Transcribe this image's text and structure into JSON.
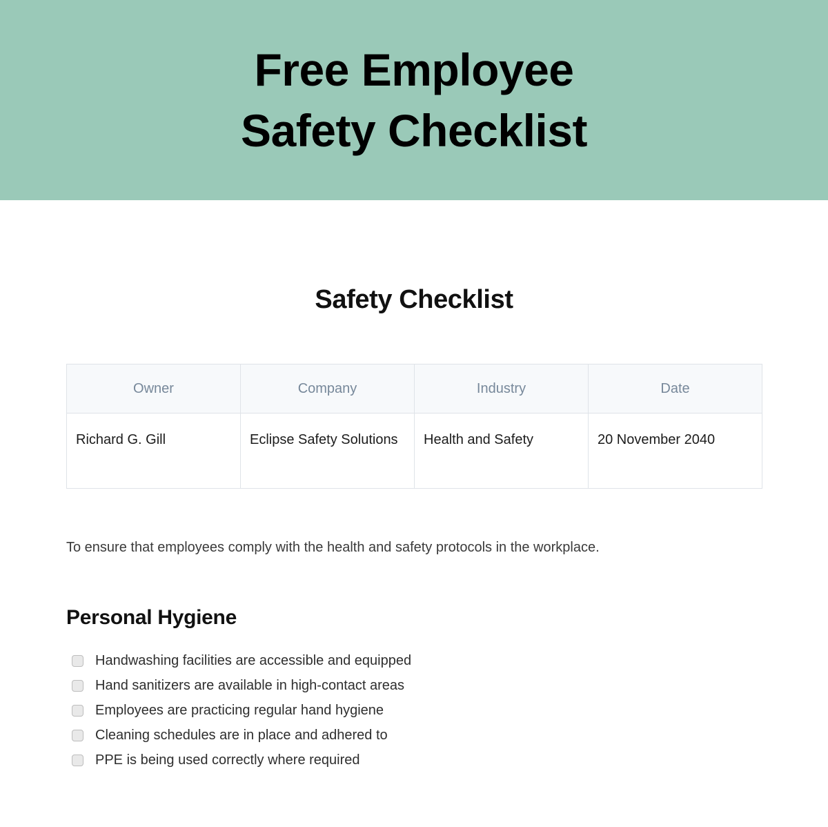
{
  "banner": {
    "title": "Free Employee Safety Checklist",
    "background_color": "#9ac9b8",
    "text_color": "#000000"
  },
  "document": {
    "title": "Safety Checklist",
    "intro": "To ensure that employees comply with the health and safety protocols in the workplace."
  },
  "info_table": {
    "header_background_color": "#f7f9fb",
    "header_text_color": "#77889a",
    "border_color": "#dfe3e8",
    "columns": [
      "Owner",
      "Company",
      "Industry",
      "Date"
    ],
    "rows": [
      [
        "Richard G. Gill",
        "Eclipse Safety Solutions",
        "Health and Safety",
        "20 November 2040"
      ]
    ]
  },
  "sections": [
    {
      "heading": "Personal Hygiene",
      "items": [
        {
          "label": "Handwashing facilities are accessible and equipped",
          "checked": false
        },
        {
          "label": "Hand sanitizers are available in high-contact areas",
          "checked": false
        },
        {
          "label": "Employees are practicing regular hand hygiene",
          "checked": false
        },
        {
          "label": "Cleaning schedules are in place and adhered to",
          "checked": false
        },
        {
          "label": "PPE is being used correctly where required",
          "checked": false
        }
      ]
    }
  ]
}
